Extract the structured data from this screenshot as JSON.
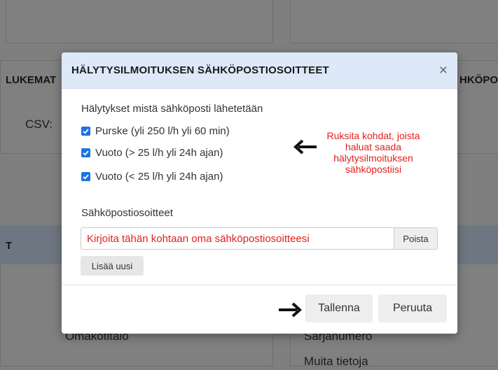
{
  "background": {
    "col_header_left": "LUKEMAT",
    "col_header_right": "HKÖPO",
    "csv_label": "CSV:",
    "row_label_left": "T",
    "cell_left": "Omakotitalo",
    "cell_right_1": "Sarjanumero",
    "cell_right_2": "Muita tietoja"
  },
  "modal": {
    "title": "HÄLYTYSILMOITUKSEN SÄHKÖPOSTIOSOITTEET",
    "close_label": "×",
    "alerts_label": "Hälytykset mistä sähköposti lähetetään",
    "checkboxes": [
      {
        "label": "Purske (yli 250 l/h yli 60 min)",
        "checked": true
      },
      {
        "label": "Vuoto (> 25 l/h yli 24h ajan)",
        "checked": true
      },
      {
        "label": "Vuoto (< 25 l/h yli 24h ajan)",
        "checked": true
      }
    ],
    "annotation": "Ruksita kohdat, joista haluat saada hälytysilmoituksen sähköpostiisi",
    "emails_label": "Sähköpostiosoitteet",
    "email_value": "Kirjoita tähän kohtaan oma sähköpostiosoitteesi",
    "remove_label": "Poista",
    "add_label": "Lisää uusi",
    "save_label": "Tallenna",
    "cancel_label": "Peruuta"
  },
  "colors": {
    "checkbox": "#1a73e8",
    "annotation": "#e41e1e",
    "header_bg": "#dde9f8"
  },
  "icons": [
    "close-icon",
    "arrow-left-icon",
    "arrow-right-icon",
    "checkmark-icon"
  ]
}
